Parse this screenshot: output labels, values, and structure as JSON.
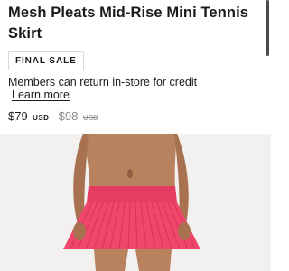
{
  "product": {
    "title": "Mesh Pleats Mid-Rise Mini Tennis Skirt",
    "badge": "FINAL SALE",
    "notice": "Members can return in-store for credit",
    "learn_more": "Learn more",
    "price": {
      "current": "$79",
      "current_currency": "USD",
      "original": "$98",
      "original_currency": "USD"
    }
  },
  "image": {
    "subject": "pink pleated tennis skirt on model",
    "skirt_color": "#f0466a",
    "background_color": "#f2f1ef"
  }
}
